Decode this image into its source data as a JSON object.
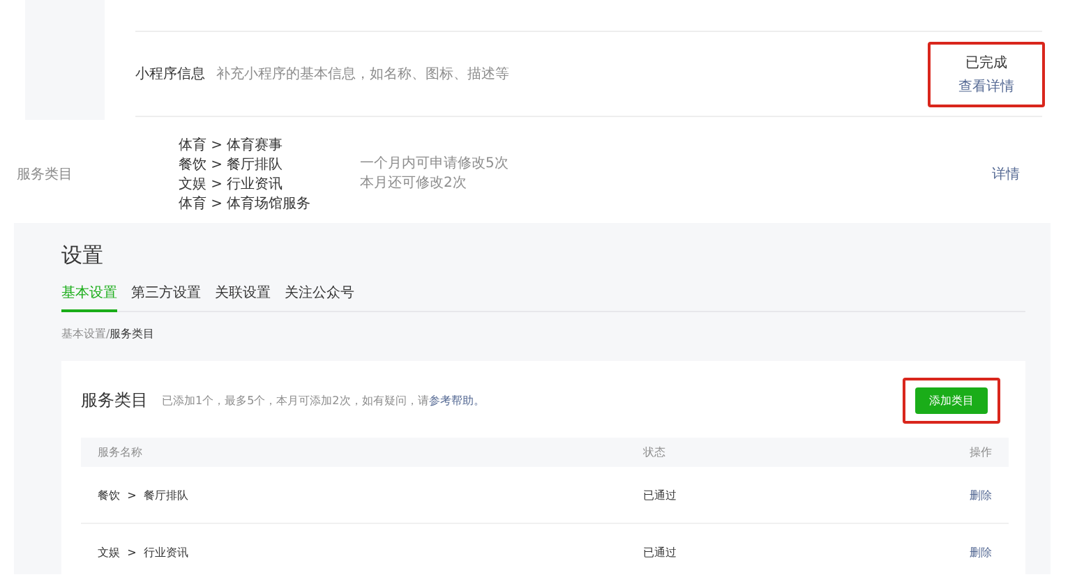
{
  "info_row": {
    "label": "小程序信息",
    "description": "补充小程序的基本信息，如名称、图标、描述等",
    "status": "已完成",
    "link": "查看详情",
    "highlighted": true
  },
  "service_row": {
    "label": "服务类目",
    "categories": [
      "体育 > 体育赛事",
      "餐饮 > 餐厅排队",
      "文娱 > 行业资讯",
      "体育 > 体育场馆服务"
    ],
    "notes": [
      "一个月内可申请修改5次",
      "本月还可修改2次"
    ],
    "link": "详情"
  },
  "settings": {
    "title": "设置",
    "tabs": [
      {
        "label": "基本设置",
        "selected": true
      },
      {
        "label": "第三方设置",
        "selected": false
      },
      {
        "label": "关联设置",
        "selected": false
      },
      {
        "label": "关注公众号",
        "selected": false
      }
    ],
    "breadcrumb": {
      "parent": "基本设置/",
      "current": "服务类目"
    },
    "card": {
      "title": "服务类目",
      "hint": "已添加1个，最多5个，本月可添加2次，如有疑问，请",
      "hint_link": "参考帮助。",
      "add_button": {
        "label": "添加类目",
        "highlighted": true
      },
      "table": {
        "columns": [
          "服务名称",
          "状态",
          "操作"
        ],
        "rows": [
          {
            "service": "餐饮  >  餐厅排队",
            "status": "已通过",
            "action": "删除"
          },
          {
            "service": "文娱  >  行业资讯",
            "status": "已通过",
            "action": "删除"
          }
        ]
      }
    }
  }
}
